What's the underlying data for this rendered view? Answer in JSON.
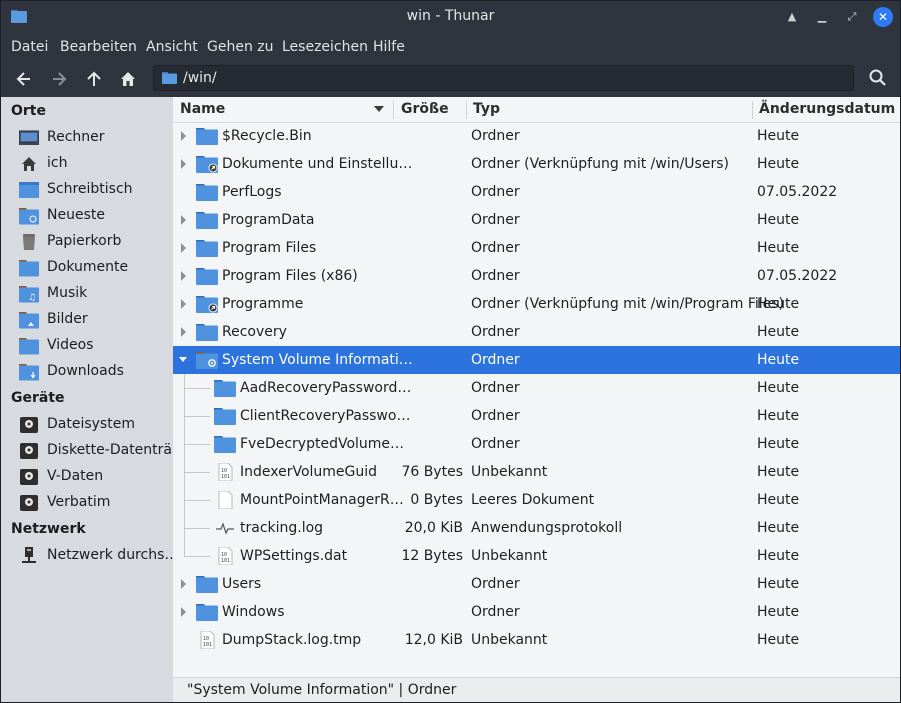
{
  "window": {
    "title": "win - Thunar"
  },
  "menu": [
    "Datei",
    "Bearbeiten",
    "Ansicht",
    "Gehen zu",
    "Lesezeichen",
    "Hilfe"
  ],
  "toolbar": {
    "path": "/win/"
  },
  "sidebar": {
    "sections": [
      {
        "title": "Orte",
        "items": [
          {
            "label": "Rechner",
            "icon": "computer-icon"
          },
          {
            "label": "ich",
            "icon": "home-icon"
          },
          {
            "label": "Schreibtisch",
            "icon": "desktop-icon"
          },
          {
            "label": "Neueste",
            "icon": "recent-folder-icon"
          },
          {
            "label": "Papierkorb",
            "icon": "trash-icon"
          },
          {
            "label": "Dokumente",
            "icon": "documents-folder-icon"
          },
          {
            "label": "Musik",
            "icon": "music-folder-icon"
          },
          {
            "label": "Bilder",
            "icon": "pictures-folder-icon"
          },
          {
            "label": "Videos",
            "icon": "videos-folder-icon"
          },
          {
            "label": "Downloads",
            "icon": "downloads-folder-icon"
          }
        ]
      },
      {
        "title": "Geräte",
        "items": [
          {
            "label": "Dateisystem",
            "icon": "drive-icon"
          },
          {
            "label": "Diskette-Datenträ…",
            "icon": "drive-icon"
          },
          {
            "label": "V-Daten",
            "icon": "drive-icon"
          },
          {
            "label": "Verbatim",
            "icon": "drive-icon"
          }
        ]
      },
      {
        "title": "Netzwerk",
        "items": [
          {
            "label": "Netzwerk durchs…",
            "icon": "network-icon"
          }
        ]
      }
    ]
  },
  "columns": {
    "name": "Name",
    "size": "Größe",
    "type": "Typ",
    "date": "Änderungsdatum"
  },
  "files": [
    {
      "name": "$Recycle.Bin",
      "size": "",
      "type": "Ordner",
      "date": "Heute",
      "kind": "folder",
      "depth": 0,
      "expander": "collapsed"
    },
    {
      "name": "Dokumente und Einstellu…",
      "size": "",
      "type": "Ordner (Verknüpfung mit /win/Users)",
      "date": "Heute",
      "kind": "folder-link",
      "depth": 0,
      "expander": "collapsed"
    },
    {
      "name": "PerfLogs",
      "size": "",
      "type": "Ordner",
      "date": "07.05.2022",
      "kind": "folder",
      "depth": 0,
      "expander": "none"
    },
    {
      "name": "ProgramData",
      "size": "",
      "type": "Ordner",
      "date": "Heute",
      "kind": "folder",
      "depth": 0,
      "expander": "collapsed"
    },
    {
      "name": "Program Files",
      "size": "",
      "type": "Ordner",
      "date": "Heute",
      "kind": "folder",
      "depth": 0,
      "expander": "collapsed"
    },
    {
      "name": "Program Files (x86)",
      "size": "",
      "type": "Ordner",
      "date": "07.05.2022",
      "kind": "folder",
      "depth": 0,
      "expander": "collapsed"
    },
    {
      "name": "Programme",
      "size": "",
      "type": "Ordner (Verknüpfung mit /win/Program Files)",
      "date": "Heute",
      "kind": "folder-link",
      "depth": 0,
      "expander": "collapsed"
    },
    {
      "name": "Recovery",
      "size": "",
      "type": "Ordner",
      "date": "Heute",
      "kind": "folder",
      "depth": 0,
      "expander": "collapsed"
    },
    {
      "name": "System Volume Informati…",
      "size": "",
      "type": "Ordner",
      "date": "Heute",
      "kind": "folder-system",
      "depth": 0,
      "expander": "expanded",
      "selected": true
    },
    {
      "name": "AadRecoveryPassword…",
      "size": "",
      "type": "Ordner",
      "date": "Heute",
      "kind": "folder",
      "depth": 1,
      "expander": "none"
    },
    {
      "name": "ClientRecoveryPasswo…",
      "size": "",
      "type": "Ordner",
      "date": "Heute",
      "kind": "folder",
      "depth": 1,
      "expander": "none"
    },
    {
      "name": "FveDecryptedVolume…",
      "size": "",
      "type": "Ordner",
      "date": "Heute",
      "kind": "folder",
      "depth": 1,
      "expander": "none"
    },
    {
      "name": "IndexerVolumeGuid",
      "size": "76 Bytes",
      "type": "Unbekannt",
      "date": "Heute",
      "kind": "binary",
      "depth": 1,
      "expander": "none"
    },
    {
      "name": "MountPointManagerR…",
      "size": "0 Bytes",
      "type": "Leeres Dokument",
      "date": "Heute",
      "kind": "document",
      "depth": 1,
      "expander": "none"
    },
    {
      "name": "tracking.log",
      "size": "20,0 KiB",
      "type": "Anwendungsprotokoll",
      "date": "Heute",
      "kind": "log",
      "depth": 1,
      "expander": "none"
    },
    {
      "name": "WPSettings.dat",
      "size": "12 Bytes",
      "type": "Unbekannt",
      "date": "Heute",
      "kind": "binary",
      "depth": 1,
      "expander": "none"
    },
    {
      "name": "Users",
      "size": "",
      "type": "Ordner",
      "date": "Heute",
      "kind": "folder",
      "depth": 0,
      "expander": "collapsed"
    },
    {
      "name": "Windows",
      "size": "",
      "type": "Ordner",
      "date": "Heute",
      "kind": "folder",
      "depth": 0,
      "expander": "collapsed"
    },
    {
      "name": "DumpStack.log.tmp",
      "size": "12,0 KiB",
      "type": "Unbekannt",
      "date": "Heute",
      "kind": "binary",
      "depth": 0,
      "expander": "none"
    }
  ],
  "status": "\"System Volume Information\"  |  Ordner",
  "colors": {
    "accent": "#2d73de",
    "folder": "#4a90d9",
    "sidebar_bg": "#d7dadf",
    "titlebar_bg": "#2f343f"
  }
}
